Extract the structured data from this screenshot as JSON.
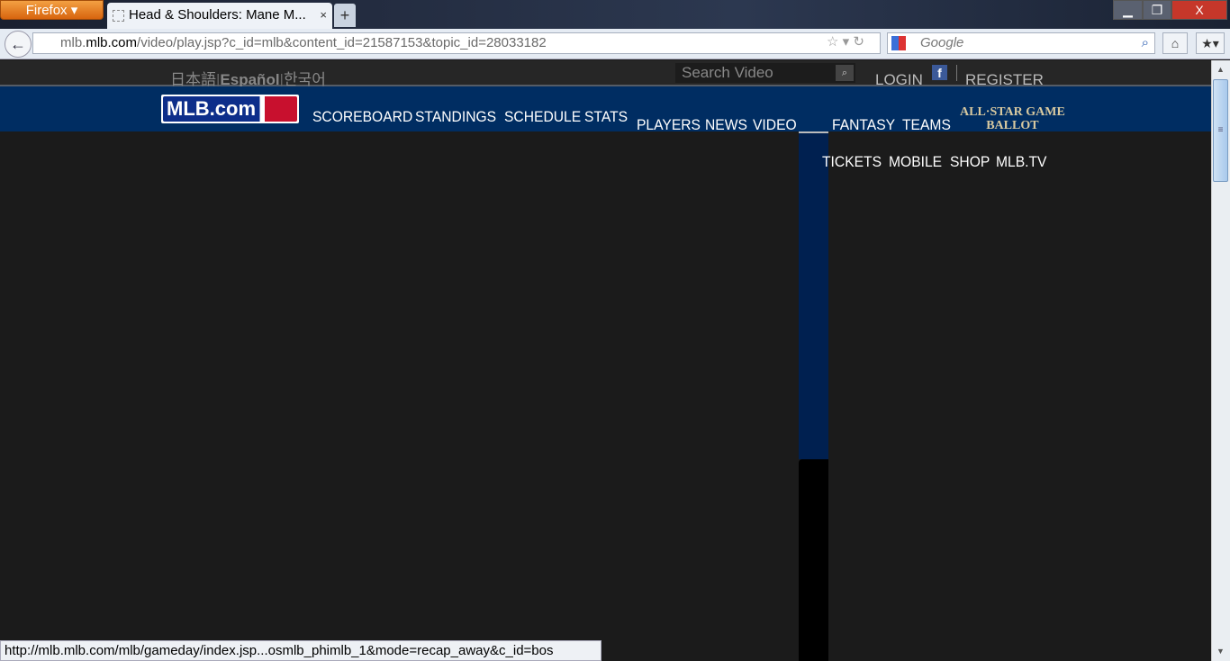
{
  "browser": {
    "menu_label": "Firefox ▾",
    "tab_title": "Head & Shoulders: Mane M...",
    "tab_close": "×",
    "new_tab": "+",
    "url_domain_pre": "mlb.",
    "url_domain": "mlb.com",
    "url_path": "/video/play.jsp?c_id=mlb&content_id=21587153&topic_id=28033182",
    "search_engine_placeholder": "Google",
    "status_text": "http://mlb.mlb.com/mlb/gameday/index.jsp...osmlb_phimlb_1&mode=recap_away&c_id=bos"
  },
  "site": {
    "languages": [
      "日本語",
      "Español",
      "한국어"
    ],
    "search_placeholder": "Search Video",
    "login": "LOGIN",
    "register": "REGISTER",
    "logo": "MLB.com",
    "nav": [
      "SCOREBOARD",
      "STANDINGS",
      "SCHEDULE",
      "STATS",
      "PLAYERS",
      "NEWS",
      "VIDEO",
      "FANTASY",
      "TEAMS",
      "TICKETS",
      "MOBILE",
      "SHOP",
      "MLB.TV"
    ],
    "allstar_line1": "ALL·STAR GAME",
    "allstar_line2": "BALLOT"
  }
}
